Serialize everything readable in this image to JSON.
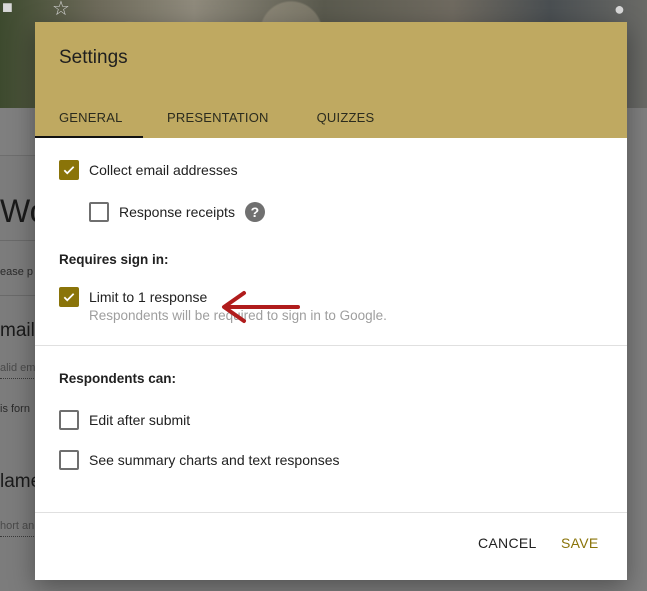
{
  "background": {
    "icons": [
      "folder-icon",
      "star-icon",
      "palette-icon"
    ],
    "form_title_fragment": "Wo",
    "description_fragment": "ease p",
    "question1_fragment": "mail",
    "question1_hint_fragment": "alid em",
    "question1_note_fragment": "is forn",
    "question2_fragment": "lame",
    "question2_hint_fragment": "hort an"
  },
  "dialog": {
    "title": "Settings",
    "tabs": [
      {
        "label": "GENERAL",
        "active": true
      },
      {
        "label": "PRESENTATION",
        "active": false
      },
      {
        "label": "QUIZZES",
        "active": false
      }
    ],
    "collect_email": {
      "label": "Collect email addresses",
      "checked": true
    },
    "response_receipts": {
      "label": "Response receipts",
      "checked": false,
      "help_icon": "?"
    },
    "requires_sign_in": {
      "heading": "Requires sign in:",
      "limit_one": {
        "label": "Limit to 1 response",
        "checked": true,
        "sublabel": "Respondents will be required to sign in to Google."
      }
    },
    "respondents_can": {
      "heading": "Respondents can:",
      "edit_after_submit": {
        "label": "Edit after submit",
        "checked": false
      },
      "see_summary": {
        "label": "See summary charts and text responses",
        "checked": false
      }
    },
    "buttons": {
      "cancel": "CANCEL",
      "save": "SAVE"
    }
  },
  "colors": {
    "header": "#bfa961",
    "accent": "#8a7409",
    "annotation_arrow": "#b01c1c"
  }
}
